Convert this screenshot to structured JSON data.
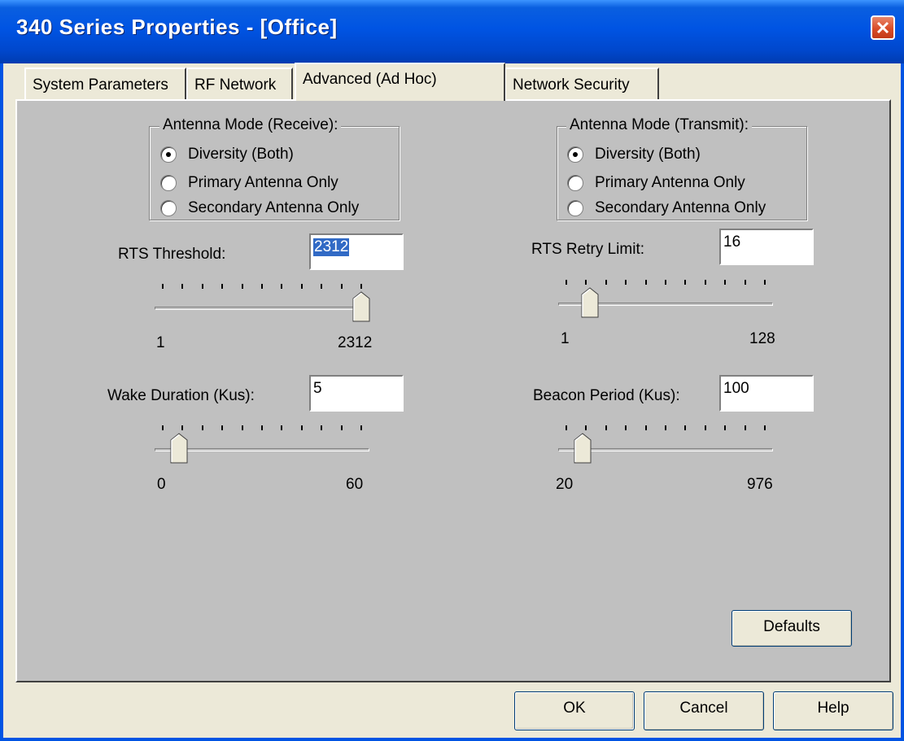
{
  "window": {
    "title": "340 Series Properties - [Office]"
  },
  "tabs": [
    {
      "label": "System Parameters",
      "active": false
    },
    {
      "label": "RF Network",
      "active": false
    },
    {
      "label": "Advanced (Ad Hoc)",
      "active": true
    },
    {
      "label": "Network Security",
      "active": false
    }
  ],
  "antenna_receive": {
    "legend": "Antenna Mode (Receive):",
    "options": [
      "Diversity (Both)",
      "Primary Antenna Only",
      "Secondary Antenna Only"
    ],
    "selected": "Diversity (Both)"
  },
  "antenna_transmit": {
    "legend": "Antenna Mode (Transmit):",
    "options": [
      "Diversity (Both)",
      "Primary Antenna Only",
      "Secondary Antenna Only"
    ],
    "selected": "Diversity (Both)"
  },
  "rts_threshold": {
    "label": "RTS Threshold:",
    "value": "2312",
    "min": "1",
    "max": "2312"
  },
  "rts_retry": {
    "label": "RTS Retry Limit:",
    "value": "16",
    "min": "1",
    "max": "128"
  },
  "wake_duration": {
    "label": "Wake Duration (Kus):",
    "value": "5",
    "min": "0",
    "max": "60"
  },
  "beacon_period": {
    "label": "Beacon Period (Kus):",
    "value": "100",
    "min": "20",
    "max": "976"
  },
  "buttons": {
    "defaults": "Defaults",
    "ok": "OK",
    "cancel": "Cancel",
    "help": "Help"
  }
}
